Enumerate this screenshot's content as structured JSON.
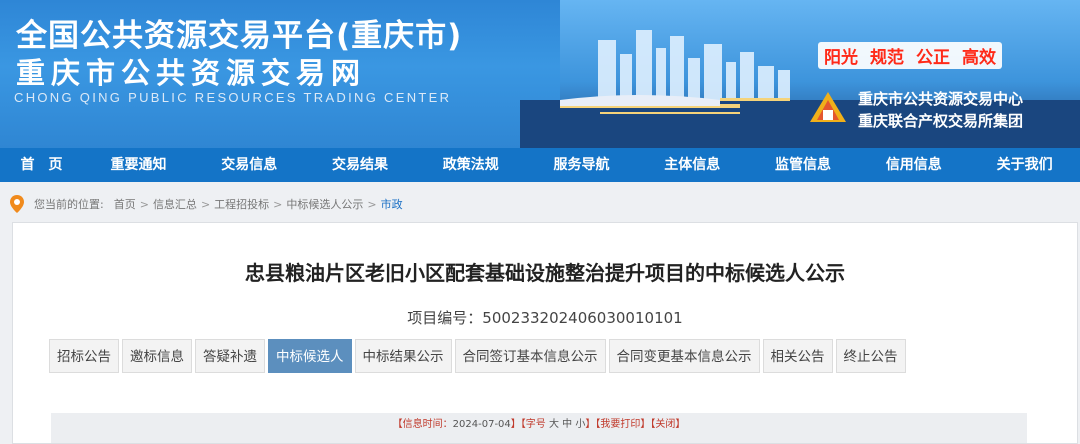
{
  "header": {
    "title_line1": "全国公共资源交易平台(重庆市)",
    "title_line2": "重庆市公共资源交易网",
    "title_en": "CHONG QING PUBLIC RESOURCES TRADING CENTER",
    "slogans": [
      "阳光",
      "规范",
      "公正",
      "高效"
    ],
    "org_line1": "重庆市公共资源交易中心",
    "org_line2": "重庆联合产权交易所集团"
  },
  "nav": {
    "items": [
      "首　页",
      "重要通知",
      "交易信息",
      "交易结果",
      "政策法规",
      "服务导航",
      "主体信息",
      "监管信息",
      "信用信息",
      "关于我们"
    ]
  },
  "breadcrumb": {
    "prefix": "您当前的位置:",
    "items": [
      "首页",
      "信息汇总",
      "工程招投标",
      "中标候选人公示",
      "市政"
    ],
    "separator": ">"
  },
  "article": {
    "title": "忠县粮油片区老旧小区配套基础设施整治提升项目的中标候选人公示",
    "project_no": "项目编号：500233202406030010101"
  },
  "tabs": {
    "items": [
      "招标公告",
      "邀标信息",
      "答疑补遗",
      "中标候选人",
      "中标结果公示",
      "合同签订基本信息公示",
      "合同变更基本信息公示",
      "相关公告",
      "终止公告"
    ],
    "active_index": 3
  },
  "info_bar": {
    "time_label": "【信息时间：",
    "time_value": "2024-07-04",
    "font_label": "】【字号",
    "font_sizes": [
      "大",
      "中",
      "小"
    ],
    "print_label": "】【我要打印】【关闭】"
  },
  "colors": {
    "nav_bg": "#1474c7",
    "slogan_red": "#ff2a18",
    "tab_active": "#5c8fbe"
  }
}
